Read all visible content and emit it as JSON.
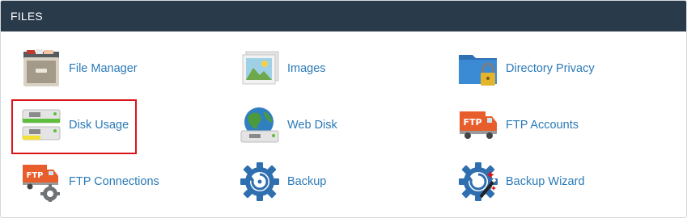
{
  "panel": {
    "title": "FILES"
  },
  "items": [
    {
      "label": "File Manager",
      "icon": "file-cabinet-icon"
    },
    {
      "label": "Images",
      "icon": "photos-icon"
    },
    {
      "label": "Directory Privacy",
      "icon": "locked-folder-icon"
    },
    {
      "label": "Disk Usage",
      "icon": "hard-drives-icon"
    },
    {
      "label": "Web Disk",
      "icon": "globe-drive-icon"
    },
    {
      "label": "FTP Accounts",
      "icon": "ftp-truck-icon"
    },
    {
      "label": "FTP Connections",
      "icon": "ftp-truck-gear-icon"
    },
    {
      "label": "Backup",
      "icon": "backup-gear-icon"
    },
    {
      "label": "Backup Wizard",
      "icon": "backup-wizard-icon"
    }
  ],
  "colors": {
    "header_bg": "#293a4a",
    "link": "#2a7ab8",
    "highlight_border": "#d9141b"
  }
}
